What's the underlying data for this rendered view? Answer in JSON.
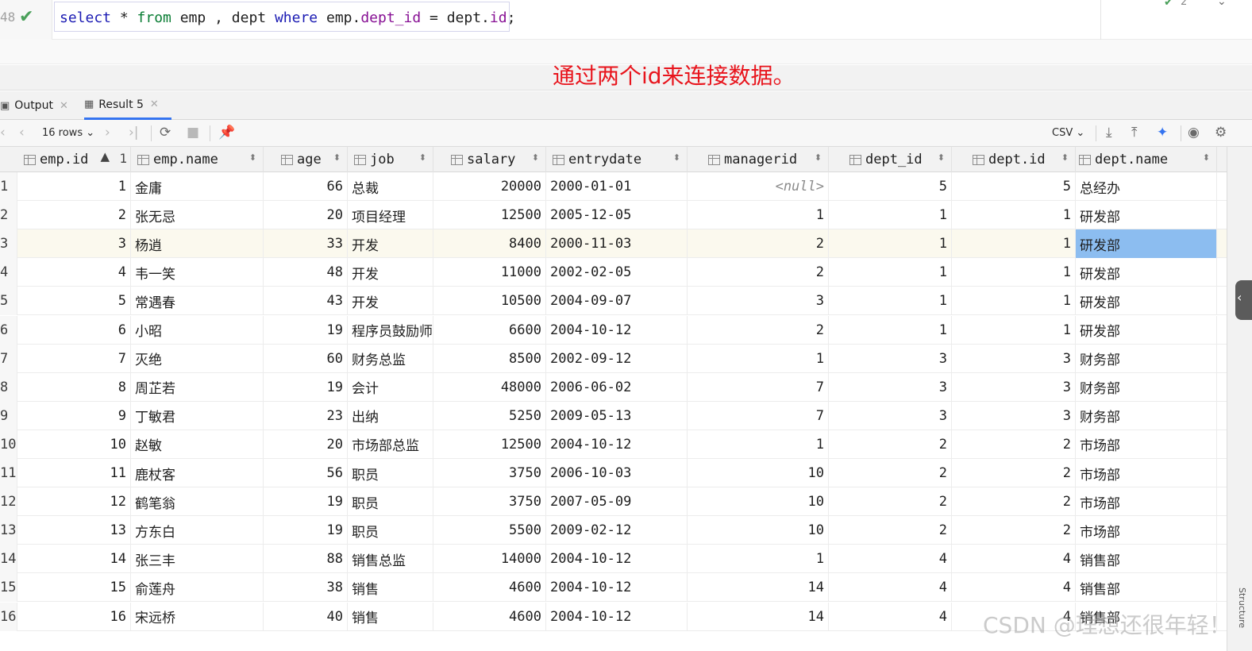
{
  "editor": {
    "line_number": "48",
    "inspection_count": "2",
    "sql": {
      "kw_select": "select",
      "star": " * ",
      "kw_from": "from",
      "t1": " emp , dept ",
      "kw_where": "where",
      "t2": " emp.",
      "f1": "dept_id",
      "eq": " = dept.",
      "f2": "id",
      "semi": ";"
    }
  },
  "annotation": "通过两个id来连接数据。",
  "tabs": [
    {
      "label": "Output"
    },
    {
      "label": "Result 5"
    }
  ],
  "toolbar": {
    "rows_label": "16 rows",
    "export_format": "CSV"
  },
  "columns": [
    {
      "label": "emp.id",
      "sort_order": "1"
    },
    {
      "label": "emp.name"
    },
    {
      "label": "age"
    },
    {
      "label": "job"
    },
    {
      "label": "salary"
    },
    {
      "label": "entrydate"
    },
    {
      "label": "managerid"
    },
    {
      "label": "dept_id"
    },
    {
      "label": "dept.id"
    },
    {
      "label": "dept.name"
    }
  ],
  "rows": [
    {
      "rn": "1",
      "id": "1",
      "name": "金庸",
      "age": "66",
      "job": "总裁",
      "salary": "20000",
      "entrydate": "2000-01-01",
      "managerid": "<null>",
      "dept_id": "5",
      "did": "5",
      "dname": "总经办"
    },
    {
      "rn": "2",
      "id": "2",
      "name": "张无忌",
      "age": "20",
      "job": "项目经理",
      "salary": "12500",
      "entrydate": "2005-12-05",
      "managerid": "1",
      "dept_id": "1",
      "did": "1",
      "dname": "研发部"
    },
    {
      "rn": "3",
      "id": "3",
      "name": "杨逍",
      "age": "33",
      "job": "开发",
      "salary": "8400",
      "entrydate": "2000-11-03",
      "managerid": "2",
      "dept_id": "1",
      "did": "1",
      "dname": "研发部"
    },
    {
      "rn": "4",
      "id": "4",
      "name": "韦一笑",
      "age": "48",
      "job": "开发",
      "salary": "11000",
      "entrydate": "2002-02-05",
      "managerid": "2",
      "dept_id": "1",
      "did": "1",
      "dname": "研发部"
    },
    {
      "rn": "5",
      "id": "5",
      "name": "常遇春",
      "age": "43",
      "job": "开发",
      "salary": "10500",
      "entrydate": "2004-09-07",
      "managerid": "3",
      "dept_id": "1",
      "did": "1",
      "dname": "研发部"
    },
    {
      "rn": "6",
      "id": "6",
      "name": "小昭",
      "age": "19",
      "job": "程序员鼓励师",
      "salary": "6600",
      "entrydate": "2004-10-12",
      "managerid": "2",
      "dept_id": "1",
      "did": "1",
      "dname": "研发部"
    },
    {
      "rn": "7",
      "id": "7",
      "name": "灭绝",
      "age": "60",
      "job": "财务总监",
      "salary": "8500",
      "entrydate": "2002-09-12",
      "managerid": "1",
      "dept_id": "3",
      "did": "3",
      "dname": "财务部"
    },
    {
      "rn": "8",
      "id": "8",
      "name": "周芷若",
      "age": "19",
      "job": "会计",
      "salary": "48000",
      "entrydate": "2006-06-02",
      "managerid": "7",
      "dept_id": "3",
      "did": "3",
      "dname": "财务部"
    },
    {
      "rn": "9",
      "id": "9",
      "name": "丁敏君",
      "age": "23",
      "job": "出纳",
      "salary": "5250",
      "entrydate": "2009-05-13",
      "managerid": "7",
      "dept_id": "3",
      "did": "3",
      "dname": "财务部"
    },
    {
      "rn": "10",
      "id": "10",
      "name": "赵敏",
      "age": "20",
      "job": "市场部总监",
      "salary": "12500",
      "entrydate": "2004-10-12",
      "managerid": "1",
      "dept_id": "2",
      "did": "2",
      "dname": "市场部"
    },
    {
      "rn": "11",
      "id": "11",
      "name": "鹿杖客",
      "age": "56",
      "job": "职员",
      "salary": "3750",
      "entrydate": "2006-10-03",
      "managerid": "10",
      "dept_id": "2",
      "did": "2",
      "dname": "市场部"
    },
    {
      "rn": "12",
      "id": "12",
      "name": "鹤笔翁",
      "age": "19",
      "job": "职员",
      "salary": "3750",
      "entrydate": "2007-05-09",
      "managerid": "10",
      "dept_id": "2",
      "did": "2",
      "dname": "市场部"
    },
    {
      "rn": "13",
      "id": "13",
      "name": "方东白",
      "age": "19",
      "job": "职员",
      "salary": "5500",
      "entrydate": "2009-02-12",
      "managerid": "10",
      "dept_id": "2",
      "did": "2",
      "dname": "市场部"
    },
    {
      "rn": "14",
      "id": "14",
      "name": "张三丰",
      "age": "88",
      "job": "销售总监",
      "salary": "14000",
      "entrydate": "2004-10-12",
      "managerid": "1",
      "dept_id": "4",
      "did": "4",
      "dname": "销售部"
    },
    {
      "rn": "15",
      "id": "15",
      "name": "俞莲舟",
      "age": "38",
      "job": "销售",
      "salary": "4600",
      "entrydate": "2004-10-12",
      "managerid": "14",
      "dept_id": "4",
      "did": "4",
      "dname": "销售部"
    },
    {
      "rn": "16",
      "id": "16",
      "name": "宋远桥",
      "age": "40",
      "job": "销售",
      "salary": "4600",
      "entrydate": "2004-10-12",
      "managerid": "14",
      "dept_id": "4",
      "did": "4",
      "dname": "销售部"
    }
  ],
  "selected_row": "3",
  "side_panel_label": "Structure",
  "watermark": "CSDN @理想还很年轻！",
  "colors": {
    "accent": "#3574f0",
    "selected_cell": "#8cbdf0",
    "annotation": "#e8141c",
    "keyword": "#1b1bb3"
  }
}
